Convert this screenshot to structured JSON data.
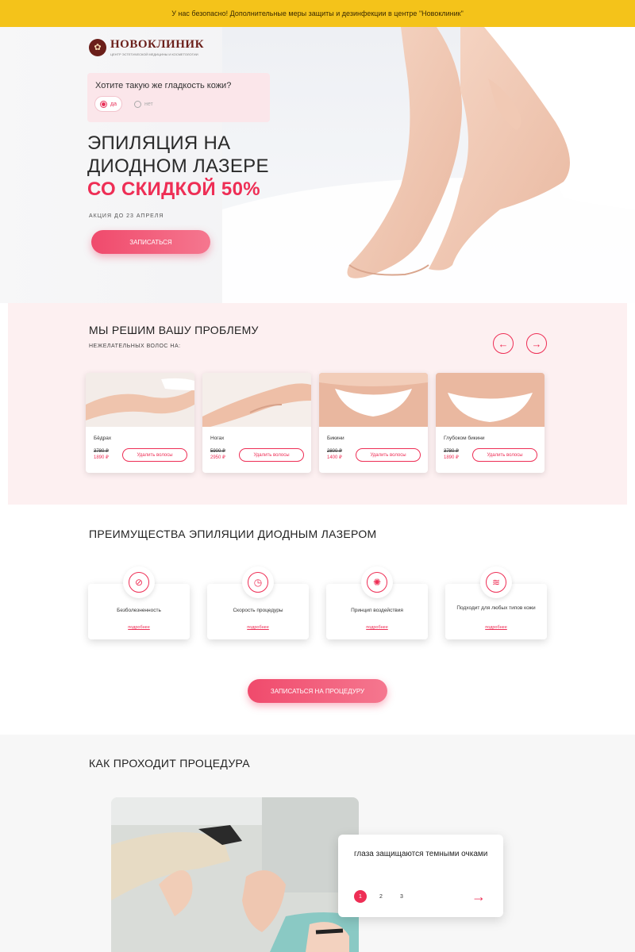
{
  "topbar": {
    "text": "У нас безопасно! Дополнительные меры защиты и дезинфекции в центре \"Новоклиник\""
  },
  "logo": {
    "name": "НОВОКЛИНИК",
    "subtitle": "ЦЕНТР ЭСТЕТИЧЕСКОЙ МЕДИЦИНЫ И КОСМЕТОЛОГИИ"
  },
  "quiz": {
    "question": "Хотите такую же гладкость кожи?",
    "options": [
      {
        "label": "да",
        "selected": true
      },
      {
        "label": "нет",
        "selected": false
      }
    ]
  },
  "hero": {
    "title_line1": "ЭПИЛЯЦИЯ НА",
    "title_line2": "ДИОДНОМ ЛАЗЕРЕ",
    "title_accent": "СО СКИДКОЙ 50%",
    "note": "АКЦИЯ ДО 23 АПРЕЛЯ",
    "cta": "ЗАПИСАТЬСЯ"
  },
  "problems": {
    "title": "МЫ РЕШИМ ВАШУ ПРОБЛЕМУ",
    "subtitle": "НЕЖЕЛАТЕЛЬНЫХ ВОЛОС НА:",
    "cards": [
      {
        "name": "Бёдрах",
        "old_price": "3780 ₽",
        "new_price": "1890 ₽",
        "button": "Удалить волосы"
      },
      {
        "name": "Ногах",
        "old_price": "5900 ₽",
        "new_price": "2950 ₽",
        "button": "Удалить волосы"
      },
      {
        "name": "Бикини",
        "old_price": "2800 ₽",
        "new_price": "1400 ₽",
        "button": "Удалить волосы"
      },
      {
        "name": "Глубоком бикини",
        "old_price": "3780 ₽",
        "new_price": "1890 ₽",
        "button": "Удалить волосы"
      }
    ]
  },
  "advantages": {
    "title": "ПРЕИМУЩЕСТВА ЭПИЛЯЦИИ ДИОДНЫМ ЛАЗЕРОМ",
    "items": [
      {
        "label": "Безболезненность",
        "link": "подробнее",
        "icon": "no-pain-icon"
      },
      {
        "label": "Скорость процедуры",
        "link": "подробнее",
        "icon": "stopwatch-icon"
      },
      {
        "label": "Принцип воздействия",
        "link": "подробнее",
        "icon": "laser-icon"
      },
      {
        "label": "Подходит для любых типов кожи",
        "link": "подробнее",
        "icon": "skin-layers-icon"
      }
    ],
    "cta": "ЗАПИСАТЬСЯ НА ПРОЦЕДУРУ"
  },
  "procedure": {
    "title": "КАК ПРОХОДИТ ПРОЦЕДУРА",
    "step_text": "глаза защищаются темными очками",
    "steps": [
      "1",
      "2",
      "3"
    ],
    "active_step": "1"
  },
  "colors": {
    "accent": "#ee2e55",
    "topbar": "#f4c31a",
    "section_bg": "#fdf0f1"
  }
}
